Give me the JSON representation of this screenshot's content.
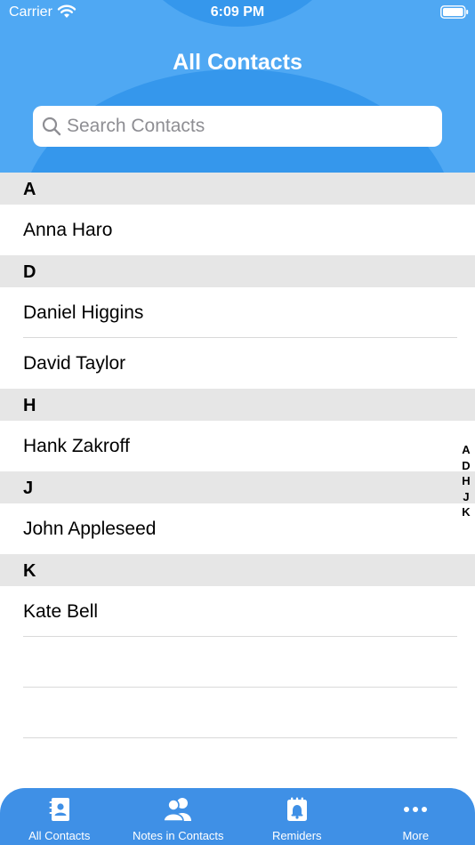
{
  "status_bar": {
    "carrier": "Carrier",
    "time": "6:09 PM"
  },
  "header": {
    "title": "All Contacts"
  },
  "search": {
    "placeholder": "Search Contacts",
    "value": ""
  },
  "sections": [
    {
      "letter": "A",
      "contacts": [
        "Anna Haro"
      ]
    },
    {
      "letter": "D",
      "contacts": [
        "Daniel Higgins",
        "David Taylor"
      ]
    },
    {
      "letter": "H",
      "contacts": [
        "Hank Zakroff"
      ]
    },
    {
      "letter": "J",
      "contacts": [
        "John Appleseed"
      ]
    },
    {
      "letter": "K",
      "contacts": [
        "Kate Bell"
      ]
    }
  ],
  "index_letters": [
    "A",
    "D",
    "H",
    "J",
    "K"
  ],
  "tabs": [
    {
      "label": "All Contacts",
      "icon": "address-book-icon"
    },
    {
      "label": "Notes in Contacts",
      "icon": "people-icon"
    },
    {
      "label": "Remiders",
      "icon": "reminder-bell-icon"
    },
    {
      "label": "More",
      "icon": "more-dots-icon"
    }
  ],
  "colors": {
    "header_bg": "#4fa8f3",
    "header_bubble": "#3597ec",
    "section_header_bg": "#e6e6e6",
    "tabbar_bg": "#3f90e6"
  }
}
